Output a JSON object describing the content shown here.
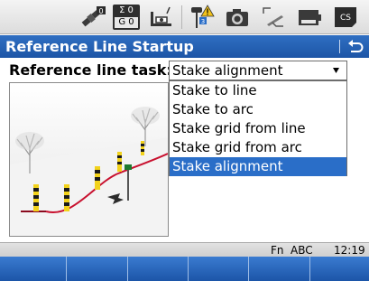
{
  "status_bar": {
    "icons": [
      "satellite-icon",
      "sigma-counter-icon",
      "level-bubble-icon",
      "rover-antenna-warning-icon",
      "camera-icon",
      "compass-orientation-icon",
      "battery-icon",
      "storage-card-icon"
    ],
    "sigma_counter": {
      "top": "Σ 0",
      "bottom": "G 0"
    },
    "satellite_count": "0",
    "storage_label": "CS"
  },
  "title_bar": {
    "title": "Reference Line Startup"
  },
  "form": {
    "task_label": "Reference line task:",
    "task_value": "Stake alignment",
    "options": [
      "Stake to line",
      "Stake to arc",
      "Stake grid from line",
      "Stake grid from arc",
      "Stake alignment"
    ],
    "selected_index": 4
  },
  "softkey_status": {
    "fn": "Fn",
    "abc": "ABC",
    "time": "12:19"
  },
  "softkeys": [
    "",
    "",
    "",
    "",
    "",
    ""
  ],
  "colors": {
    "title_bar": "#1f5aac",
    "selection": "#2a6ec8",
    "softkeys": "#2a64b8"
  }
}
